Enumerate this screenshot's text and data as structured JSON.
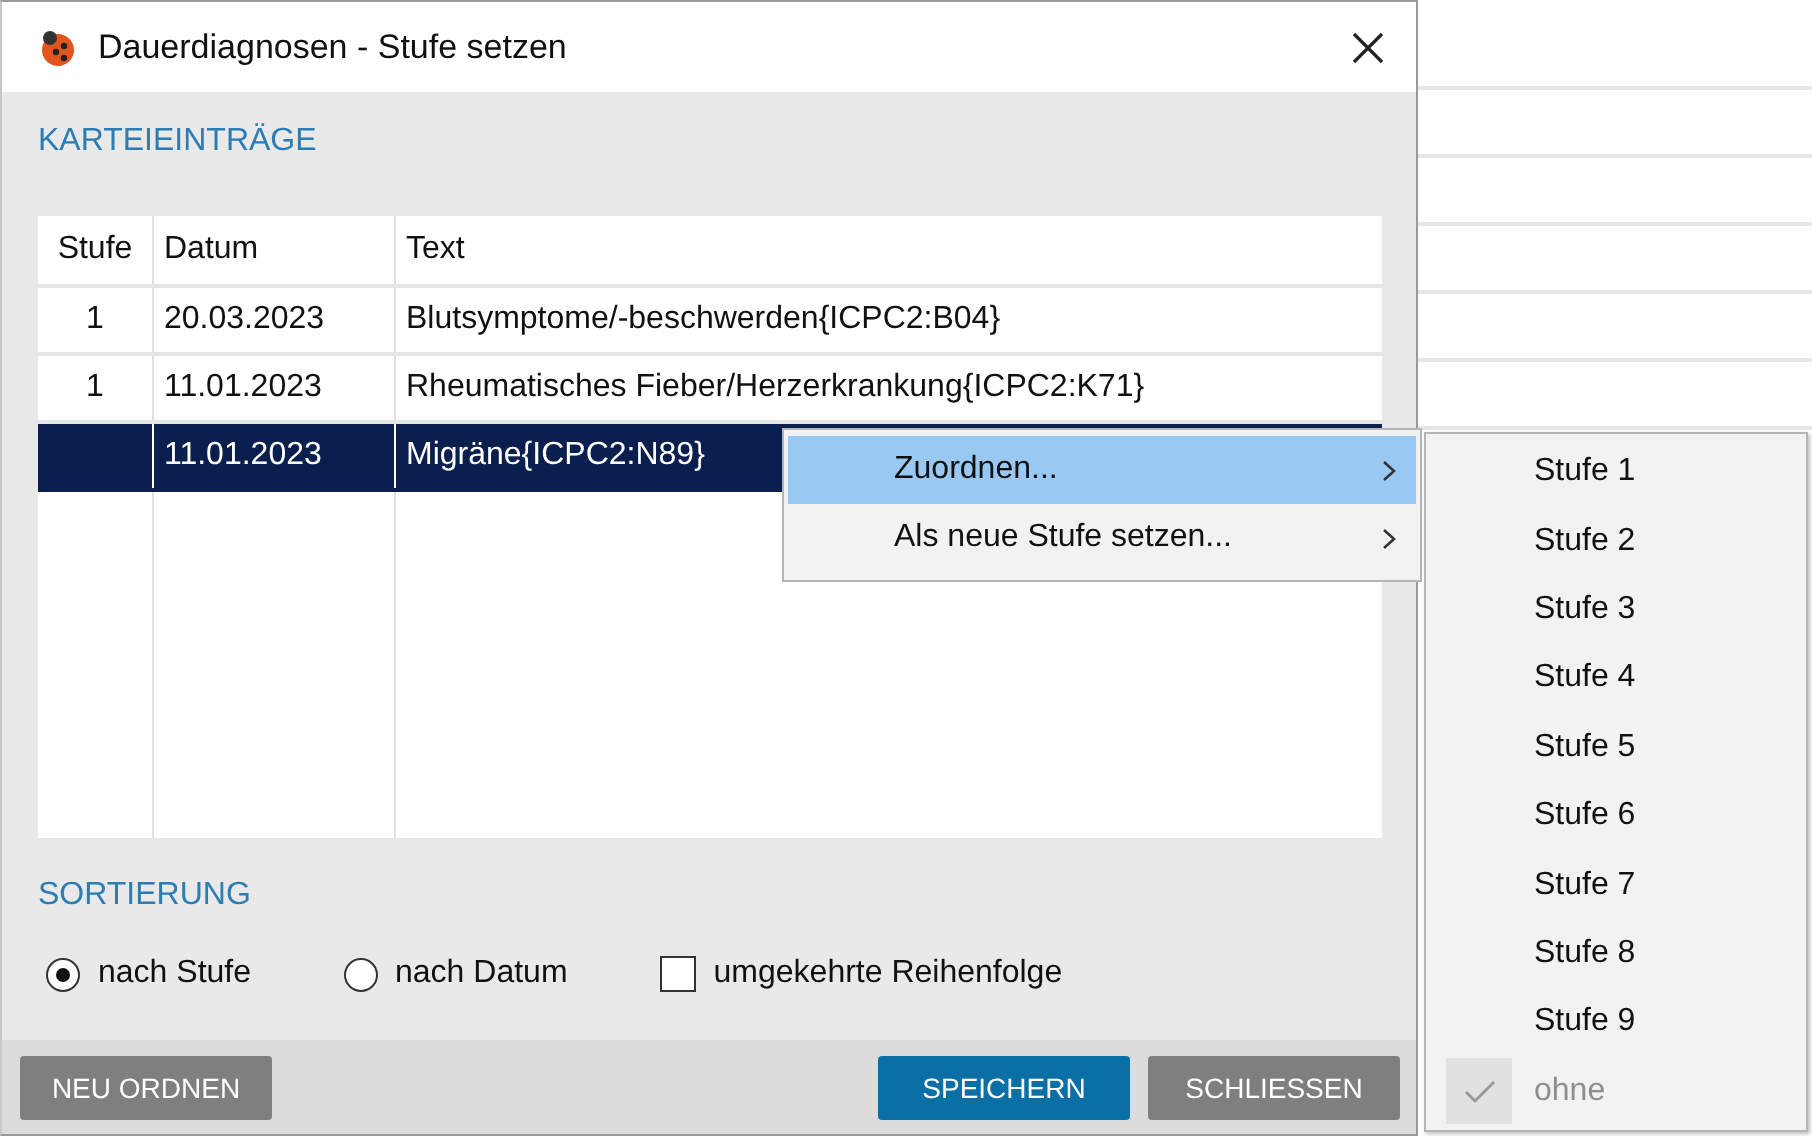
{
  "window": {
    "title": "Dauerdiagnosen - Stufe setzen"
  },
  "entries": {
    "heading": "KARTEIEINTRÄGE",
    "table": {
      "columns": [
        "Stufe",
        "Datum",
        "Text"
      ],
      "rows": [
        {
          "cells": [
            "1",
            "20.03.2023",
            "Blutsymptome/-beschwerden{ICPC2:B04}"
          ],
          "selected": false
        },
        {
          "cells": [
            "1",
            "11.01.2023",
            "Rheumatisches Fieber/Herzerkrankung{ICPC2:K71}"
          ],
          "selected": false
        },
        {
          "cells": [
            "",
            "11.01.2023",
            "Migräne{ICPC2:N89}"
          ],
          "selected": true
        }
      ]
    }
  },
  "sorting": {
    "heading": "SORTIERUNG",
    "options": [
      {
        "kind": "radio",
        "label": "nach Stufe",
        "selected": true
      },
      {
        "kind": "radio",
        "label": "nach Datum",
        "selected": false
      },
      {
        "kind": "checkbox",
        "label": "umgekehrte Reihenfolge",
        "checked": false
      }
    ]
  },
  "buttons": [
    {
      "kind": "secondary",
      "label": "NEU ORDNEN"
    },
    {
      "kind": "primary",
      "label": "SPEICHERN"
    },
    {
      "kind": "secondary",
      "label": "SCHLIESSEN"
    }
  ],
  "context_menu": {
    "items": [
      {
        "label": "Zuordnen...",
        "selected": true
      },
      {
        "label": "Als neue Stufe setzen...",
        "selected": false
      }
    ]
  },
  "submenu": {
    "items": [
      {
        "label": "Stufe 1",
        "checked": false,
        "disabled": false
      },
      {
        "label": "Stufe 2",
        "checked": false,
        "disabled": false
      },
      {
        "label": "Stufe 3",
        "checked": false,
        "disabled": false
      },
      {
        "label": "Stufe 4",
        "checked": false,
        "disabled": false
      },
      {
        "label": "Stufe 5",
        "checked": false,
        "disabled": false
      },
      {
        "label": "Stufe 6",
        "checked": false,
        "disabled": false
      },
      {
        "label": "Stufe 7",
        "checked": false,
        "disabled": false
      },
      {
        "label": "Stufe 8",
        "checked": false,
        "disabled": false
      },
      {
        "label": "Stufe 9",
        "checked": false,
        "disabled": false
      },
      {
        "label": "ohne",
        "checked": true,
        "disabled": true
      }
    ]
  }
}
